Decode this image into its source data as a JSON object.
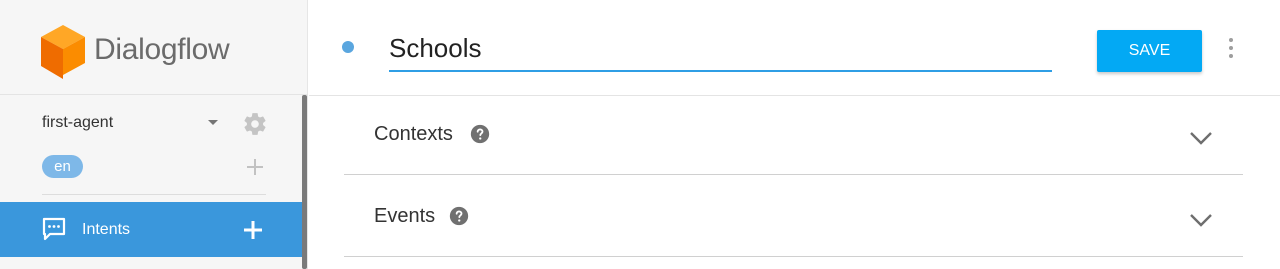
{
  "brand": {
    "name": "Dialogflow"
  },
  "sidebar": {
    "agent": {
      "name": "first-agent"
    },
    "language": {
      "code": "en"
    },
    "nav": [
      {
        "label": "Intents",
        "active": true
      }
    ]
  },
  "header": {
    "intent_name": "Schools",
    "save_label": "SAVE"
  },
  "sections": [
    {
      "title": "Contexts"
    },
    {
      "title": "Events"
    }
  ],
  "colors": {
    "accent": "#03a9f4",
    "nav_active": "#3a97dc",
    "status_dot": "#5aa6df",
    "logo_orange": "#f57c00"
  },
  "icons": {
    "logo": "dialogflow-cube-icon",
    "agent_menu": "caret-down-icon",
    "settings": "gear-icon",
    "add_language": "plus-icon",
    "intents": "chat-bubble-icon",
    "add_intent": "plus-icon",
    "more": "more-vert-icon",
    "help": "help-circle-icon",
    "expand": "chevron-down-icon"
  }
}
